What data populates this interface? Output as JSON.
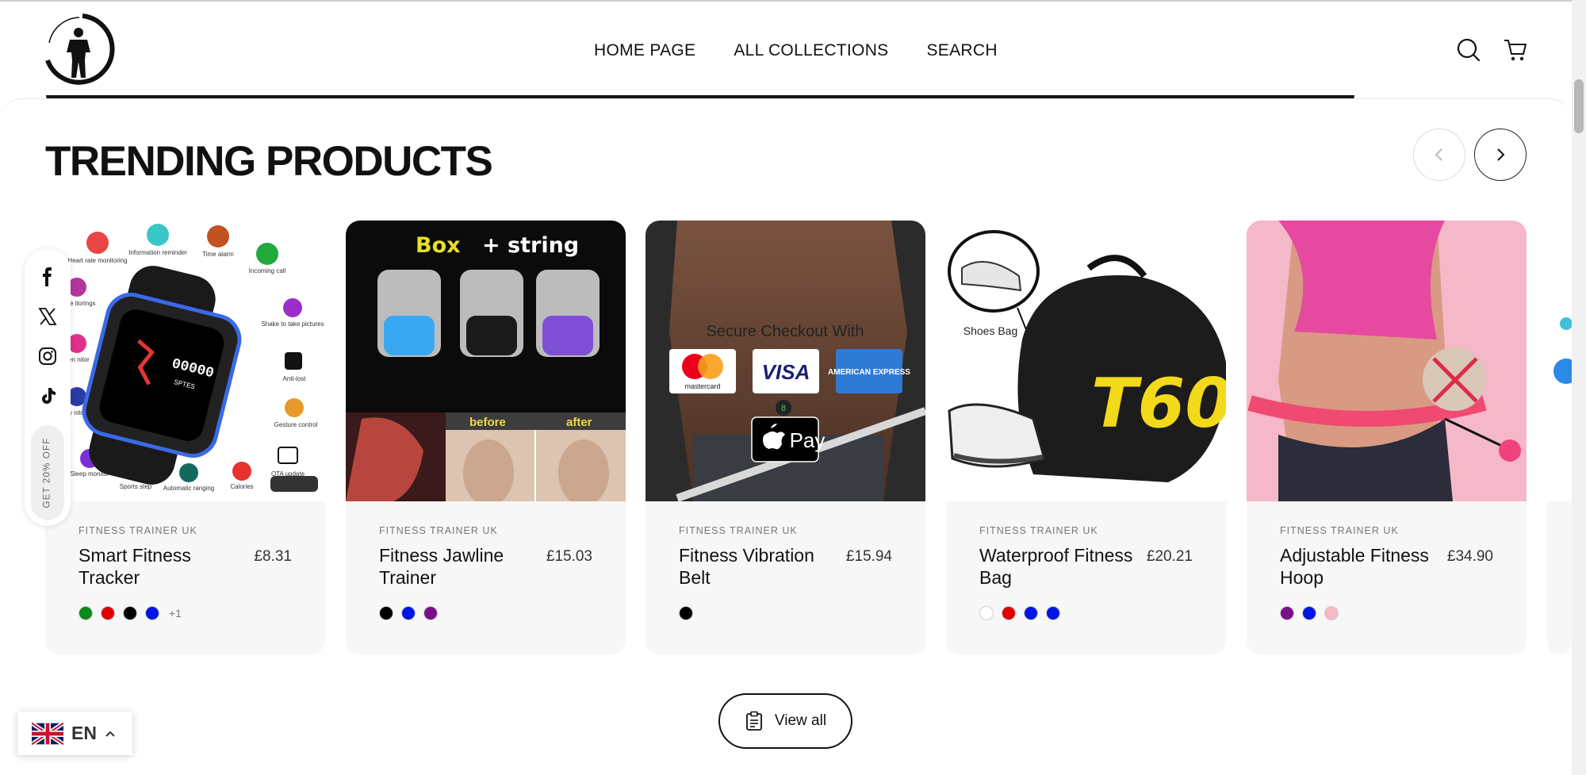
{
  "header": {
    "logo_name": "fitness-trainer-logo",
    "nav": [
      {
        "label": "HOME PAGE"
      },
      {
        "label": "ALL COLLECTIONS"
      },
      {
        "label": "SEARCH"
      }
    ],
    "icons": [
      "search-icon",
      "cart-icon"
    ]
  },
  "section": {
    "title": "TRENDING PRODUCTS",
    "prev_icon": "chevron-left-icon",
    "next_icon": "chevron-right-icon"
  },
  "products": [
    {
      "vendor": "FITNESS TRAINER UK",
      "name": "Smart Fitness Tracker",
      "price": "£8.31",
      "swatches": [
        "#0a8a1a",
        "#e00000",
        "#000000",
        "#0014e6"
      ],
      "more": "+1"
    },
    {
      "vendor": "FITNESS TRAINER UK",
      "name": "Fitness Jawline Trainer",
      "price": "£15.03",
      "swatches": [
        "#000000",
        "#0014e6",
        "#7a0f8a"
      ],
      "more": ""
    },
    {
      "vendor": "FITNESS TRAINER UK",
      "name": "Fitness Vibration Belt",
      "price": "£15.94",
      "swatches": [
        "#000000"
      ],
      "more": ""
    },
    {
      "vendor": "FITNESS TRAINER UK",
      "name": "Waterproof Fitness Bag",
      "price": "£20.21",
      "swatches": [
        "#ffffff",
        "#e00000",
        "#0014e6",
        "#0014e6"
      ],
      "more": ""
    },
    {
      "vendor": "FITNESS TRAINER UK",
      "name": "Adjustable Fitness Hoop",
      "price": "£34.90",
      "swatches": [
        "#7a0f8a",
        "#0014e6",
        "#f8b7c4"
      ],
      "more": ""
    }
  ],
  "images": {
    "tracker": {
      "features": [
        "Heart rate monitoring",
        "Information reminder",
        "Time alarm",
        "Incoming call",
        "pressure itorings",
        "Shake to take pictures",
        "oxygen nitor",
        "Anti-lost",
        "ntary nitor",
        "Gesture control",
        "Sleep monitor",
        "Sports step",
        "Automatic ranging",
        "Calories",
        "OTA update"
      ],
      "screen_text": "00000",
      "screen_sub": "SPTES"
    },
    "jawline": {
      "heading_a": "Box",
      "heading_b": "+ string",
      "before": "before",
      "after": "after"
    },
    "belt": {
      "checkout": "Secure Checkout With",
      "cards": [
        "mastercard",
        "VISA",
        "AMERICAN EXPRESS"
      ],
      "pay": "Pay",
      "digit": "8"
    },
    "bag": {
      "label": "Shoes Bag",
      "brand": "T60"
    }
  },
  "social": {
    "items": [
      "facebook-icon",
      "x-icon",
      "instagram-icon",
      "tiktok-icon"
    ],
    "promo": "GET 20% OFF"
  },
  "view_all": {
    "label": "View all"
  },
  "language": {
    "code": "EN"
  },
  "colors": {
    "accent": "#111111",
    "card_bg": "#f7f7f7"
  }
}
